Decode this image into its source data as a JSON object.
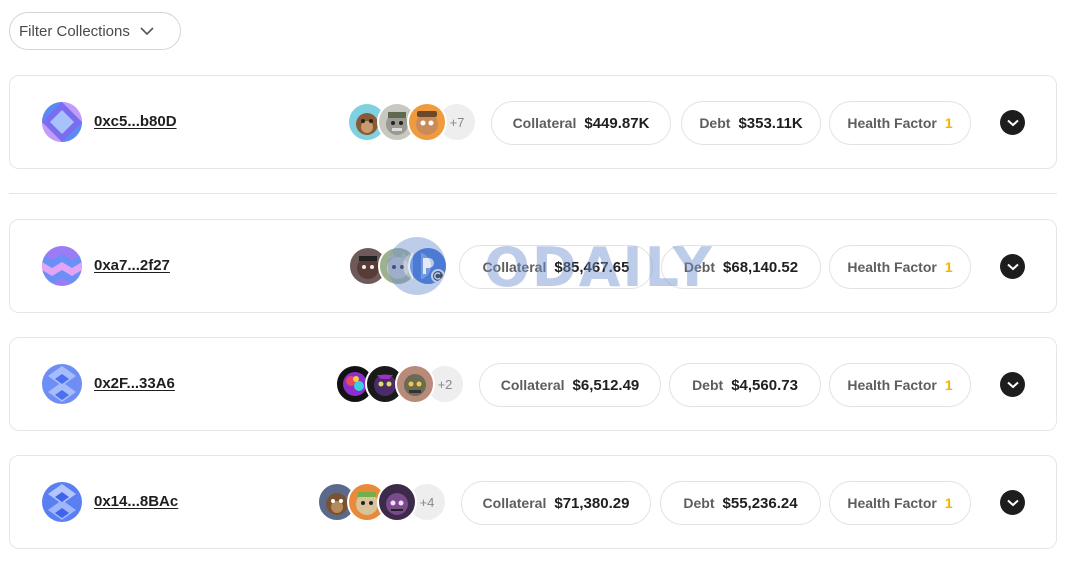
{
  "filter": {
    "label": "Filter Collections"
  },
  "rows": [
    {
      "address": "0xc5...b80D",
      "nft_more": "+7",
      "collateral_label": "Collateral",
      "collateral": "$449.87K",
      "debt_label": "Debt",
      "debt": "$353.11K",
      "hf_label": "Health Factor",
      "hf": "1"
    },
    {
      "address": "0xa7...2f27",
      "nft_more": "",
      "collateral_label": "Collateral",
      "collateral": "$85,467.65",
      "debt_label": "Debt",
      "debt": "$68,140.52",
      "hf_label": "Health Factor",
      "hf": "1"
    },
    {
      "address": "0x2F...33A6",
      "nft_more": "+2",
      "collateral_label": "Collateral",
      "collateral": "$6,512.49",
      "debt_label": "Debt",
      "debt": "$4,560.73",
      "hf_label": "Health Factor",
      "hf": "1"
    },
    {
      "address": "0x14...8BAc",
      "nft_more": "+4",
      "collateral_label": "Collateral",
      "collateral": "$71,380.29",
      "debt_label": "Debt",
      "debt": "$55,236.24",
      "hf_label": "Health Factor",
      "hf": "1"
    }
  ],
  "watermark": {
    "text": "ODAILY"
  },
  "colors": {
    "health_factor": "#f2b400",
    "expand_button": "#1d1d1d",
    "border": "#e6e6e6"
  },
  "icons": {
    "filter": "chevron-down-icon",
    "expand": "chevron-down-icon"
  }
}
